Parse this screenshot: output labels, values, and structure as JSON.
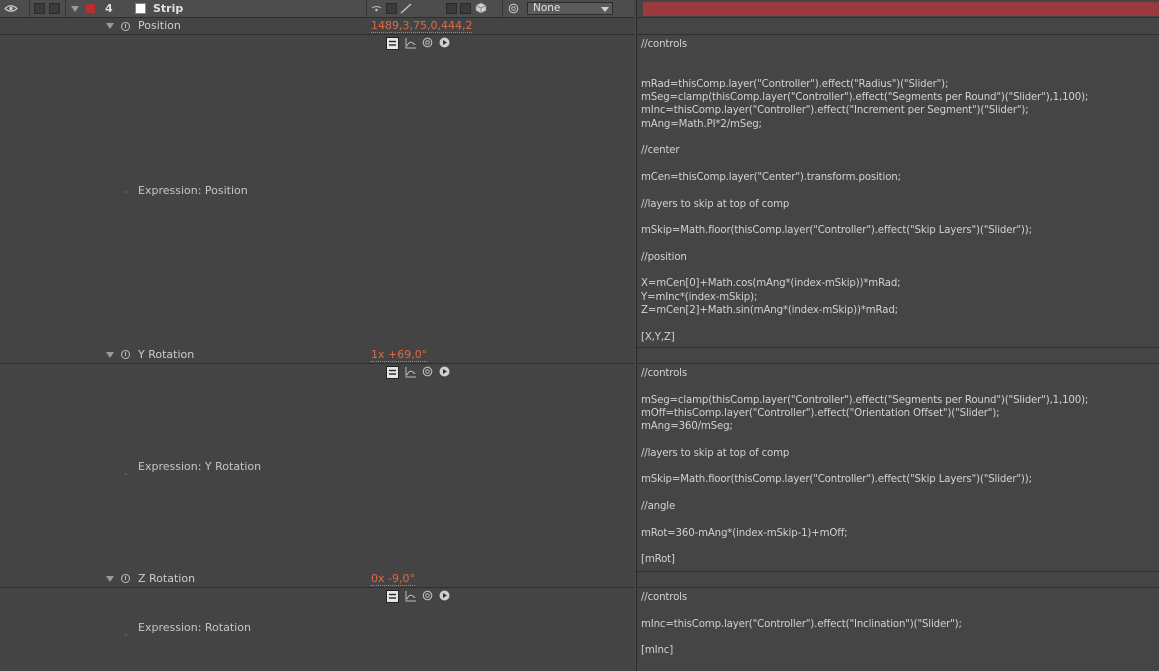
{
  "layer": {
    "number": "4",
    "name": "Strip",
    "color": "#b5302f",
    "parent_select": "None",
    "bar_color": "#9b3a3e"
  },
  "properties": [
    {
      "name": "Position",
      "value": "1489,3,75,0,444,2",
      "expression_label": "Expression: Position",
      "code": "//controls\n\n\nmRad=thisComp.layer(\"Controller\").effect(\"Radius\")(\"Slider\");\nmSeg=clamp(thisComp.layer(\"Controller\").effect(\"Segments per Round\")(\"Slider\"),1,100);\nmInc=thisComp.layer(\"Controller\").effect(\"Increment per Segment\")(\"Slider\");\nmAng=Math.PI*2/mSeg;\n\n//center\n\nmCen=thisComp.layer(\"Center\").transform.position;\n\n//layers to skip at top of comp\n\nmSkip=Math.floor(thisComp.layer(\"Controller\").effect(\"Skip Layers\")(\"Slider\"));\n\n//position\n\nX=mCen[0]+Math.cos(mAng*(index-mSkip))*mRad;\nY=mInc*(index-mSkip);\nZ=mCen[2]+Math.sin(mAng*(index-mSkip))*mRad;\n\n[X,Y,Z]"
    },
    {
      "name": "Y Rotation",
      "value": "1x +69,0°",
      "expression_label": "Expression: Y Rotation",
      "code": "//controls\n\nmSeg=clamp(thisComp.layer(\"Controller\").effect(\"Segments per Round\")(\"Slider\"),1,100);\nmOff=thisComp.layer(\"Controller\").effect(\"Orientation Offset\")(\"Slider\");\nmAng=360/mSeg;\n\n//layers to skip at top of comp\n\nmSkip=Math.floor(thisComp.layer(\"Controller\").effect(\"Skip Layers\")(\"Slider\"));\n\n//angle\n\nmRot=360-mAng*(index-mSkip-1)+mOff;\n\n[mRot]"
    },
    {
      "name": "Z Rotation",
      "value": "0x -9,0°",
      "expression_label": "Expression: Rotation",
      "code": "//controls\n\nmInc=thisComp.layer(\"Controller\").effect(\"Inclination\")(\"Slider\");\n\n[mInc]"
    }
  ],
  "icons": {
    "eye": "eye-icon",
    "stopwatch": "stopwatch-icon",
    "expr_enable": "expression-enable-icon",
    "graph": "graph-editor-icon",
    "pickwhip": "pickwhip-icon",
    "language_menu": "expression-language-menu-icon",
    "shy": "shy-icon",
    "quality": "quality-icon",
    "3d": "3d-layer-icon",
    "parent_spiral": "parent-pickwhip-icon"
  }
}
